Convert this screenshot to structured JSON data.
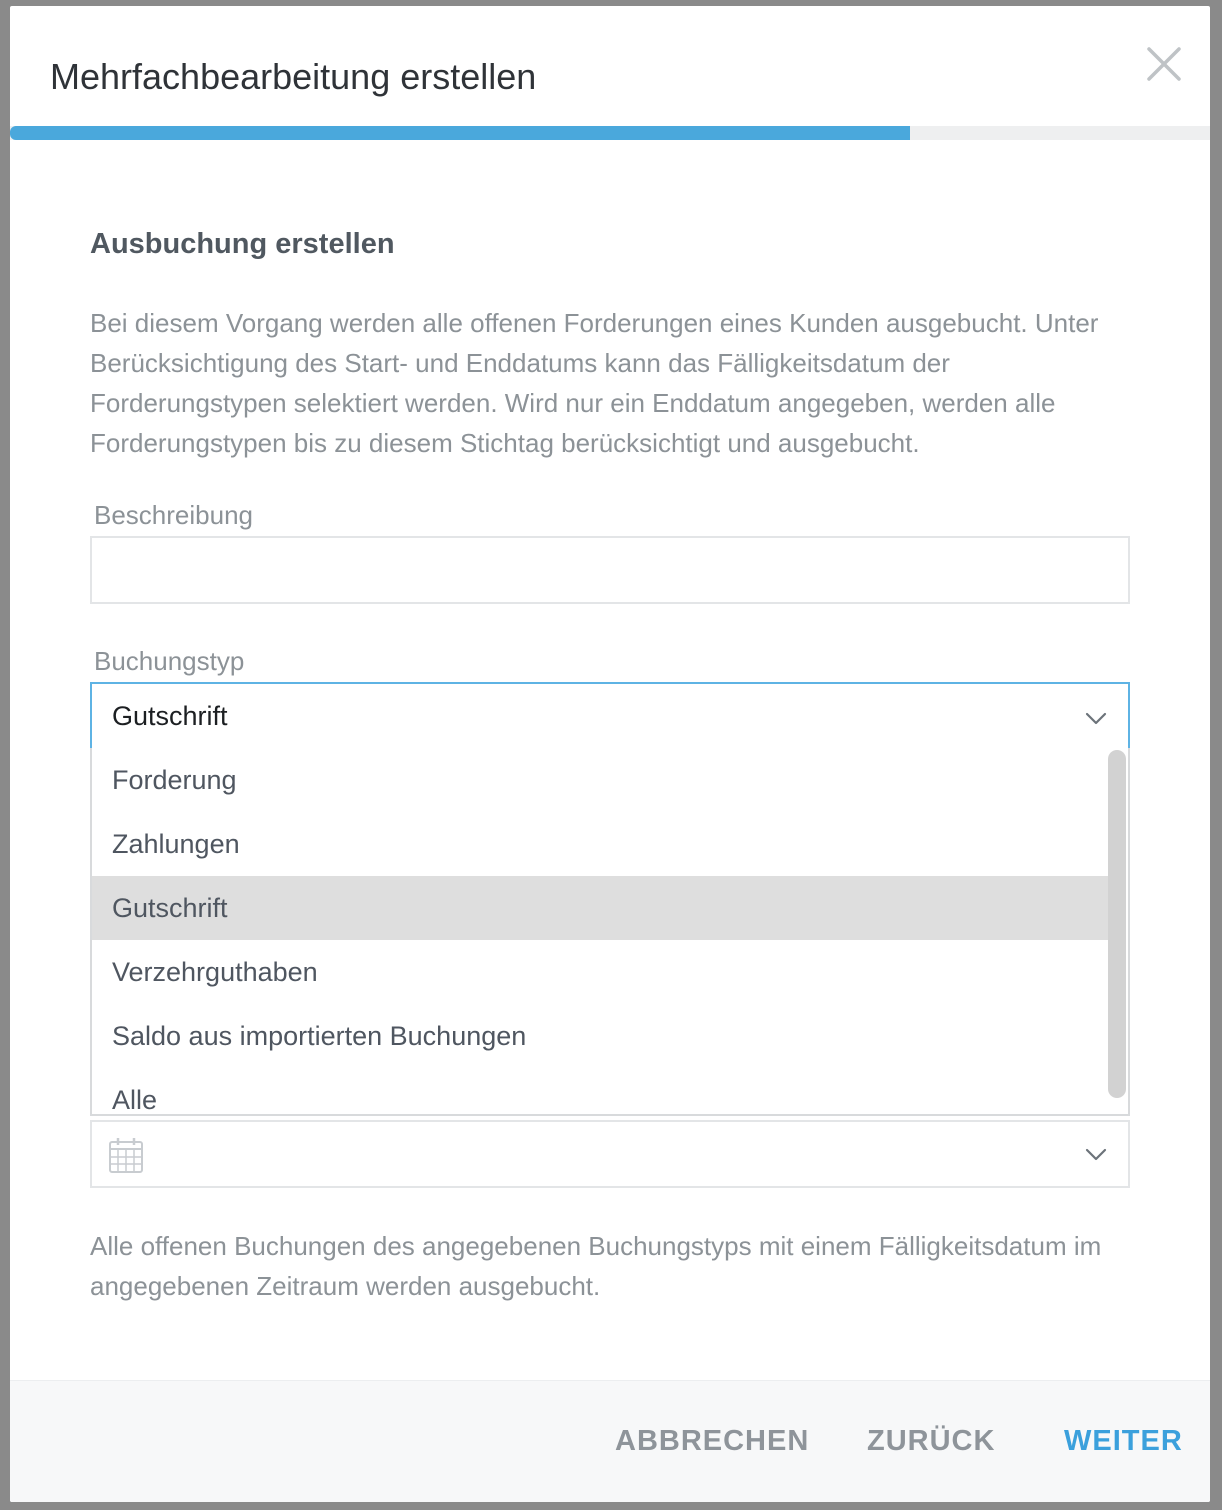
{
  "modal": {
    "title": "Mehrfachbearbeitung erstellen",
    "progress_fraction": 0.75
  },
  "section": {
    "title": "Ausbuchung erstellen",
    "description": "Bei diesem Vorgang werden alle offenen Forderungen eines Kunden ausgebucht. Unter Berücksichtigung des Start- und Enddatums kann das Fälligkeitsdatum der Forderungstypen selektiert werden. Wird nur ein Enddatum angegeben, werden alle Forderungstypen bis zu diesem Stichtag berücksichtigt und ausgebucht."
  },
  "fields": {
    "beschreibung_label": "Beschreibung",
    "beschreibung_value": "",
    "buchungstyp_label": "Buchungstyp",
    "buchungstyp_selected": "Gutschrift",
    "buchungstyp_options": [
      "Forderung",
      "Zahlungen",
      "Gutschrift",
      "Verzehrguthaben",
      "Saldo aus importierten Buchungen",
      "Alle"
    ]
  },
  "hint": "Alle offenen Buchungen des angegebenen Buchungstyps mit einem Fälligkeitsdatum im angegebenen Zeitraum werden ausgebucht.",
  "footer": {
    "cancel_label": "ABBRECHEN",
    "back_label": "ZURÜCK",
    "next_label": "WEITER"
  },
  "colors": {
    "accent": "#4aa8dc",
    "selected_option_bg": "#dedede"
  },
  "icons": {
    "close": "close-icon",
    "chevron": "chevron-down-icon",
    "calendar": "calendar-icon"
  }
}
